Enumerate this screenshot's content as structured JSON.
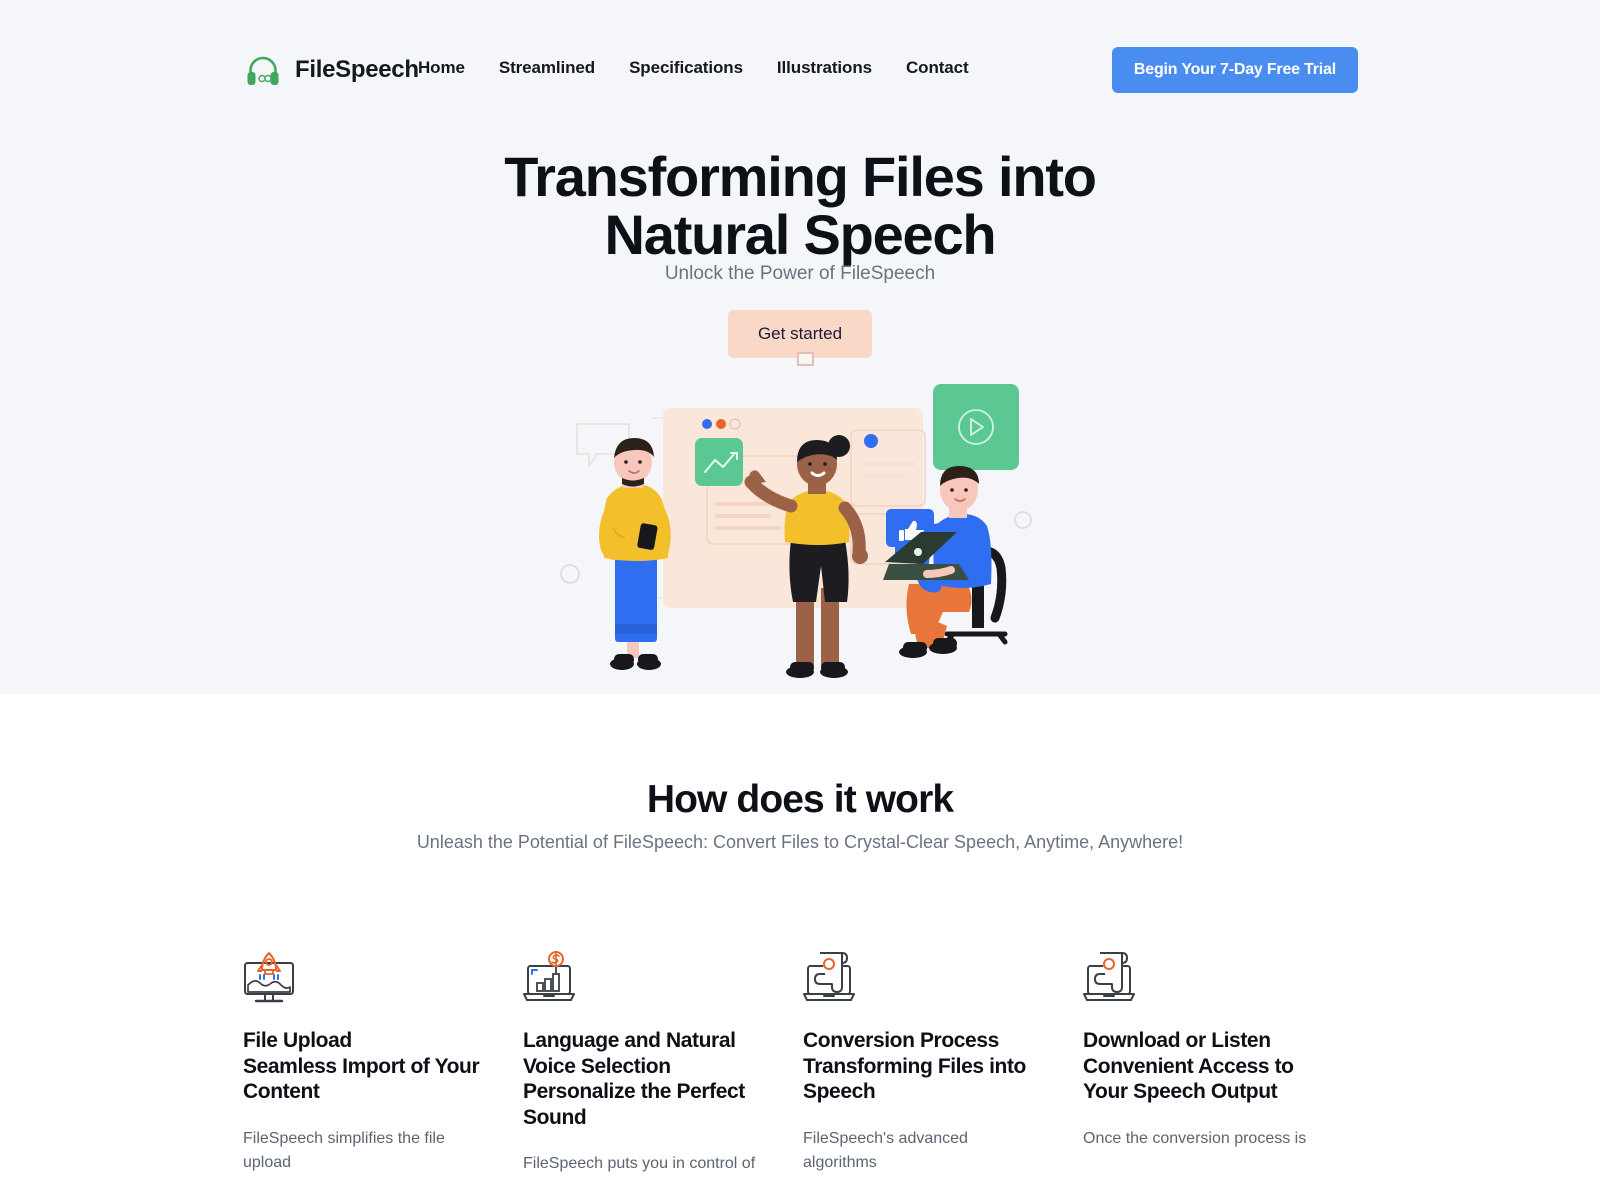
{
  "colors": {
    "hero_bg": "#f5f6f9",
    "page_bg": "#ffffff",
    "nav_cta_bg": "#4a8df0",
    "hero_btn_bg": "#f9d8c7",
    "heading": "#0d1117",
    "muted": "#6b7280",
    "accent_green": "#5bc894",
    "accent_orange": "#e8642b",
    "accent_blue": "#2f6ef0",
    "accent_yellow": "#f3c02b"
  },
  "nav": {
    "logo_icon": "headphones-infinity-icon",
    "brand": "FileSpeech",
    "links": [
      {
        "label": "Home"
      },
      {
        "label": "Streamlined"
      },
      {
        "label": "Specifications"
      },
      {
        "label": "Illustrations"
      },
      {
        "label": "Contact"
      }
    ],
    "cta_label": "Begin Your 7-Day Free Trial"
  },
  "hero": {
    "title_line1": "Transforming Files into",
    "title_line2": "Natural Speech",
    "subtitle": "Unlock the Power of FileSpeech",
    "button_label": "Get started",
    "illustration_name": "team-collaboration-illustration"
  },
  "how": {
    "title": "How does it work",
    "subtitle": "Unleash the Potential of FileSpeech: Convert Files to Crystal-Clear Speech, Anytime, Anywhere!"
  },
  "features": [
    {
      "icon": "monitor-rocket-icon",
      "title": "File Upload\nSeamless Import of Your\nContent",
      "body": "FileSpeech simplifies the file upload"
    },
    {
      "icon": "laptop-chart-dollar-icon",
      "title": "Language and Natural\nVoice Selection\nPersonalize the Perfect\nSound",
      "body": "FileSpeech puts you in control of"
    },
    {
      "icon": "laptop-document-icon",
      "title": "Conversion Process\nTransforming Files into\nSpeech",
      "body": "FileSpeech's advanced algorithms"
    },
    {
      "icon": "laptop-document-icon",
      "title": "Download or Listen\nConvenient Access to\nYour Speech Output",
      "body": "Once the conversion process is"
    }
  ]
}
